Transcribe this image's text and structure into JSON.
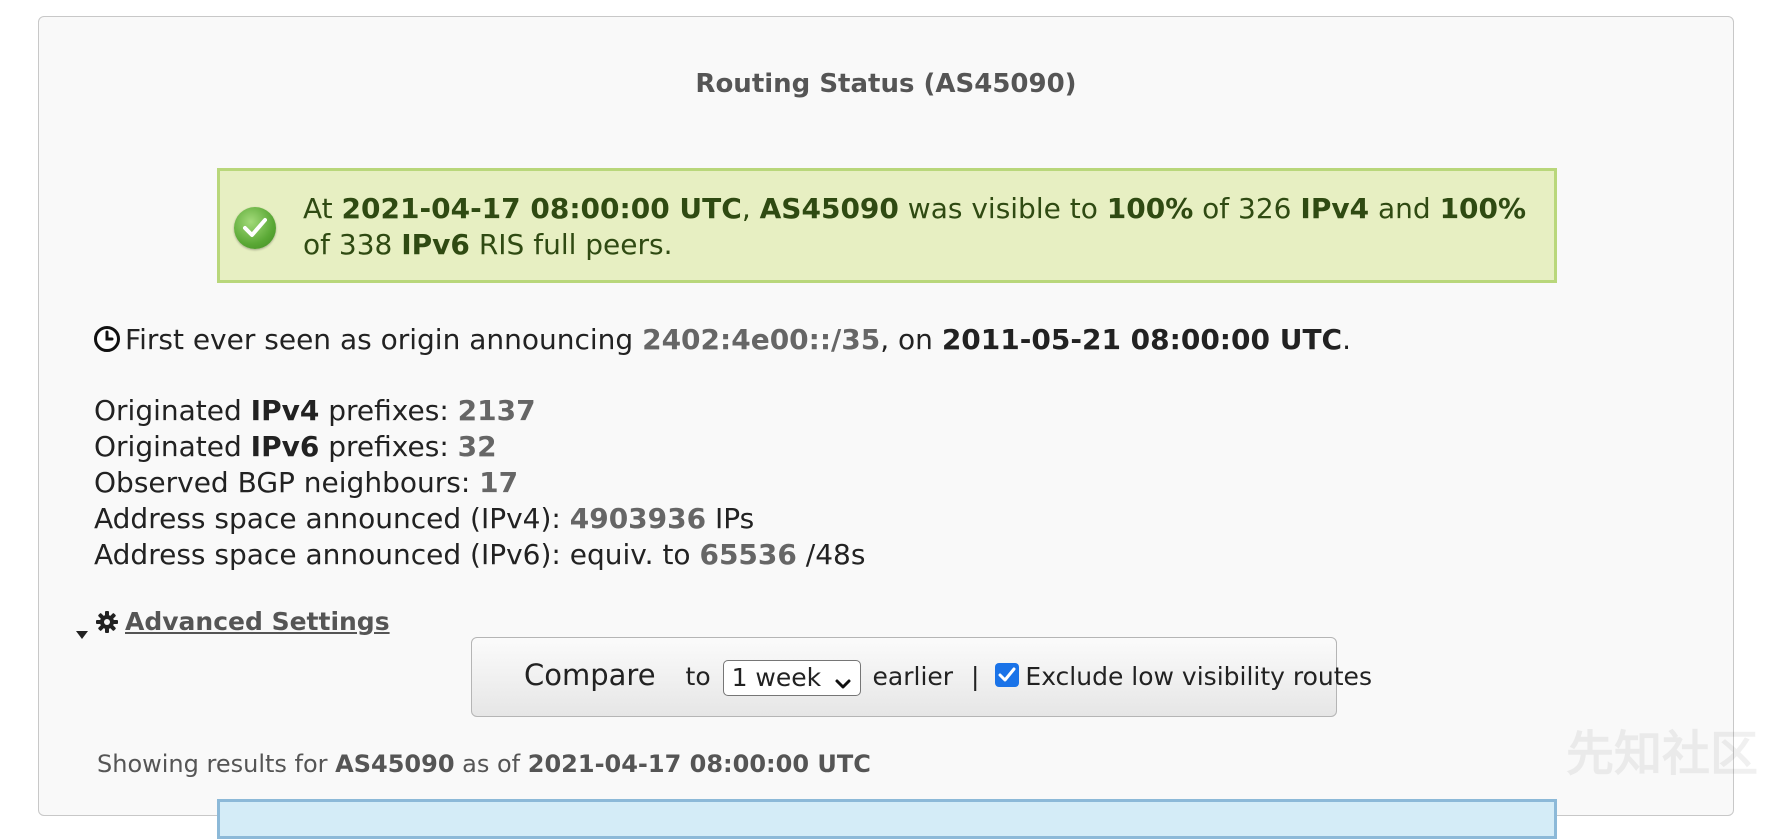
{
  "panel": {
    "title": "Routing Status (AS45090)"
  },
  "status": {
    "prefix": "At ",
    "datetime": "2021-04-17 08:00:00 UTC",
    "comma": ", ",
    "asn": "AS45090",
    "text1": " was visible to ",
    "pct_v4": "100%",
    "text2": " of 326 ",
    "ipv4": "IPv4",
    "text3": " and ",
    "pct_v6": "100%",
    "text4": " of 338 ",
    "ipv6": "IPv6",
    "text5": " RIS full peers."
  },
  "first_seen": {
    "prefix": "First ever seen as origin announcing ",
    "prefix_value": "2402:4e00::/35",
    "middle": ", on ",
    "date": "2011-05-21 08:00:00 UTC",
    "suffix": "."
  },
  "stats": {
    "v4_pre": "Originated ",
    "v4_bold": "IPv4",
    "v4_post": " prefixes: ",
    "v4_value": "2137",
    "v6_pre": "Originated ",
    "v6_bold": "IPv6",
    "v6_post": " prefixes: ",
    "v6_value": "32",
    "neigh_label": "Observed BGP neighbours: ",
    "neigh_value": "17",
    "space_v4_label": "Address space announced (IPv4): ",
    "space_v4_value": "4903936",
    "space_v4_unit": " IPs",
    "space_v6_label": "Address space announced (IPv6): equiv. to ",
    "space_v6_value": "65536",
    "space_v6_unit": " /48s"
  },
  "advanced": {
    "label": "Advanced Settings"
  },
  "compare": {
    "label": "Compare",
    "to": "to",
    "selected": "1 week",
    "earlier": "earlier",
    "separator": "|",
    "checkbox_label": "Exclude low visibility routes",
    "checkbox_checked": true
  },
  "showing": {
    "prefix": "Showing results for ",
    "asn": "AS45090",
    "middle": " as of ",
    "datetime": "2021-04-17 08:00:00 UTC"
  },
  "watermark": "先知社区",
  "colors": {
    "status_bg": "#e7efc2",
    "status_border": "#b9d77b",
    "info_bg": "#d4ecf7",
    "checkbox": "#1a73e8"
  }
}
